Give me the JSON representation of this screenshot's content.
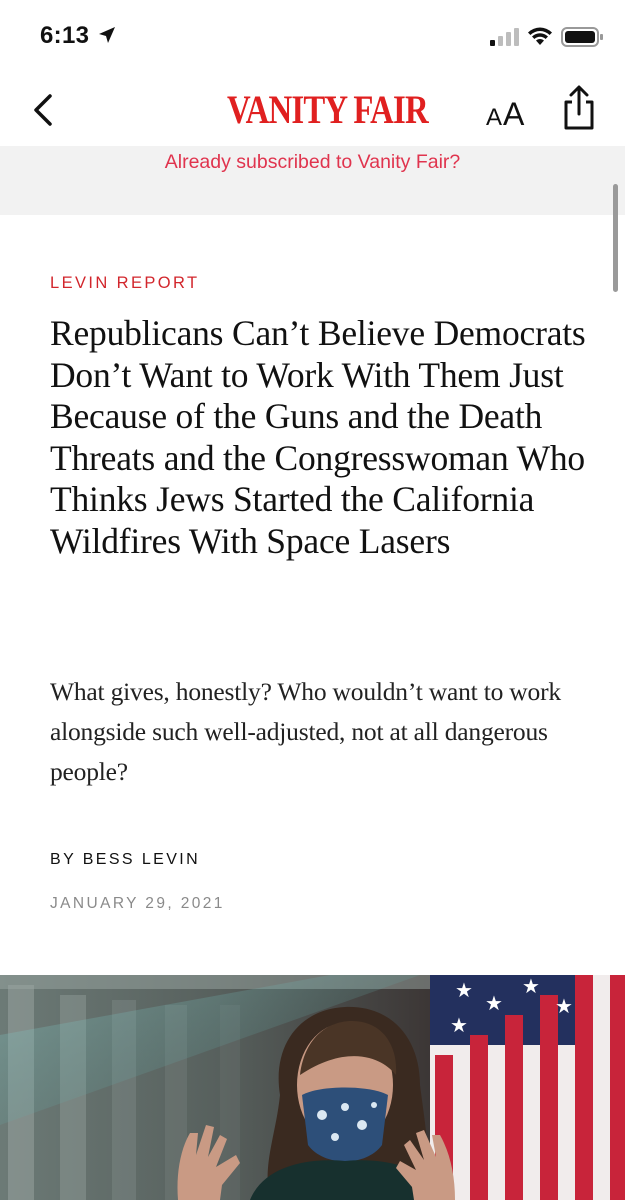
{
  "status_bar": {
    "time": "6:13"
  },
  "nav": {
    "logo": "VANITY FAIR",
    "text_size_small": "A",
    "text_size_large": "A"
  },
  "banner": {
    "subscribe_text": "Already subscribed to Vanity Fair?"
  },
  "article": {
    "rubric": "LEVIN REPORT",
    "headline": "Republicans Can’t Believe Democrats Don’t Want to Work With Them Just Because of the Guns and the Death Threats and the Congresswoman Who Thinks Jews Started the California Wildfires With Space Lasers",
    "dek": "What gives, honestly? Who wouldn’t want to work alongside such well-adjusted, not at all dangerous people?",
    "byline_prefix": "BY",
    "author": "BESS LEVIN",
    "date": "JANUARY 29, 2021"
  },
  "colors": {
    "brand_red": "#e02020",
    "rubric_red": "#d2262c",
    "link_pink": "#e0344e",
    "banner_bg": "#f2f2f2"
  },
  "icons": [
    "location-arrow-icon",
    "signal-icon",
    "wifi-icon",
    "battery-icon",
    "chevron-left-icon",
    "share-icon"
  ]
}
